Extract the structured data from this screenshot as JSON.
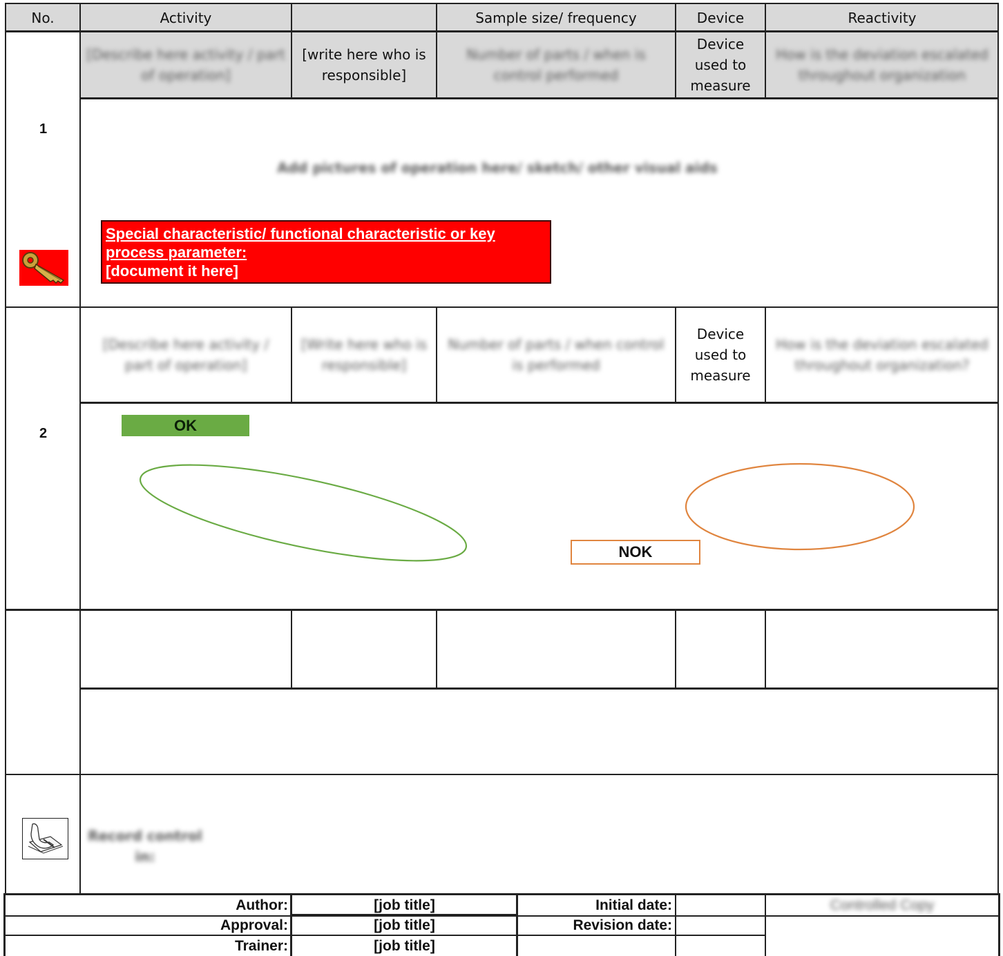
{
  "header": {
    "no": "No.",
    "activity": "Activity",
    "responsible": "",
    "sample": "Sample size/ frequency",
    "device": "Device",
    "reactivity": "Reactivity"
  },
  "step1": {
    "number": "1",
    "activity": "[Describe here activity / part of operation]",
    "responsible": "[write here who is responsible]",
    "sample": "Number of parts / when is control performed",
    "device": "Device used to measure",
    "reactivity": "How is the deviation escalated throughout organization",
    "pictures_note": "Add pictures of operation here/ sketch/ other visual aids",
    "special_line1": "Special characteristic/ functional characteristic or key",
    "special_line2": "process parameter:",
    "special_line3": "[document it here]",
    "key_icon": "key-icon"
  },
  "step2": {
    "number": "2",
    "activity": "[Describe here activity / part of operation]",
    "responsible": "[Write here who is responsible]",
    "sample": "Number of parts / when control is performed",
    "device": "Device used to measure",
    "reactivity": "How is the deviation escalated throughout organization?",
    "ok_label": "OK",
    "nok_label": "NOK",
    "ok_color": "#6aab44",
    "nok_color": "#e0853f"
  },
  "record": {
    "icon": "writing-hand-icon",
    "text": "Record control in:"
  },
  "footer": {
    "author_label": "Author:",
    "author_value": "[job title]",
    "approval_label": "Approval:",
    "approval_value": "[job title]",
    "trainer_label": "Trainer:",
    "trainer_value": "[job title]",
    "initial_date_label": "Initial date:",
    "revision_date_label": "Revision date:",
    "controlled_copy": "Controlled Copy"
  },
  "colors": {
    "header_bg": "#d9d9d9",
    "special_bg": "#ff0000"
  }
}
